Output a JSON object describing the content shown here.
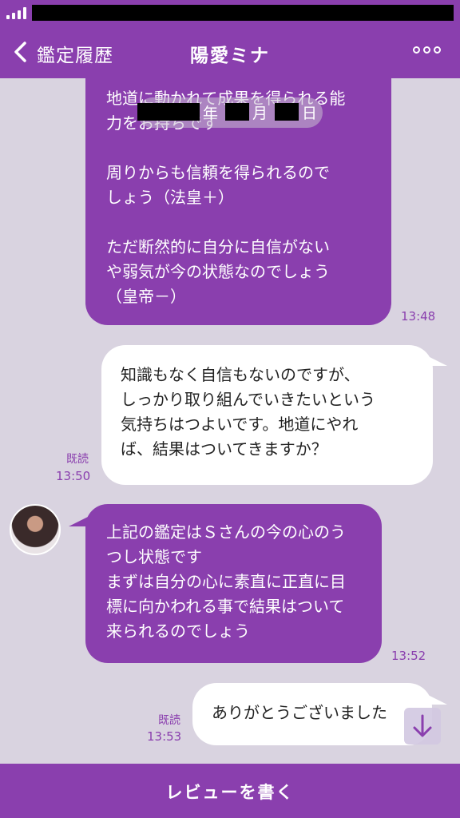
{
  "header": {
    "back_label": "鑑定履歴",
    "title": "陽愛ミナ"
  },
  "date_separator": {
    "year_suffix": "年",
    "month_suffix": "月",
    "day_suffix": "日"
  },
  "messages": [
    {
      "side": "left",
      "text": "地道に動かれて成果を得られる能\n力をお持ちです\n\n周りからも信頼を得られるので\nしょう（法皇＋）\n\nただ断然的に自分に自信がない\nや弱気が今の状態なのでしょう\n（皇帝－）",
      "time": "13:48"
    },
    {
      "side": "right",
      "text": "知識もなく自信もないのですが、\nしっかり取り組んでいきたいという\n気持ちはつよいです。地道にやれ\nば、結果はついてきますか？",
      "read": "既読",
      "time": "13:50"
    },
    {
      "side": "left",
      "text": "上記の鑑定はＳさんの今の心のう\nつし状態です\nまずは自分の心に素直に正直に目\n標に向かわれる事で結果はついて\n来られるのでしょう",
      "time": "13:52"
    },
    {
      "side": "right",
      "text": "ありがとうございました",
      "read": "既読",
      "time": "13:53"
    }
  ],
  "footer": {
    "review_label": "レビューを書く"
  },
  "colors": {
    "accent": "#8a3fae",
    "background": "#d9d3e0"
  },
  "icons": {
    "back": "chevron-left-icon",
    "more": "more-options-icon",
    "scroll": "arrow-down-icon"
  }
}
